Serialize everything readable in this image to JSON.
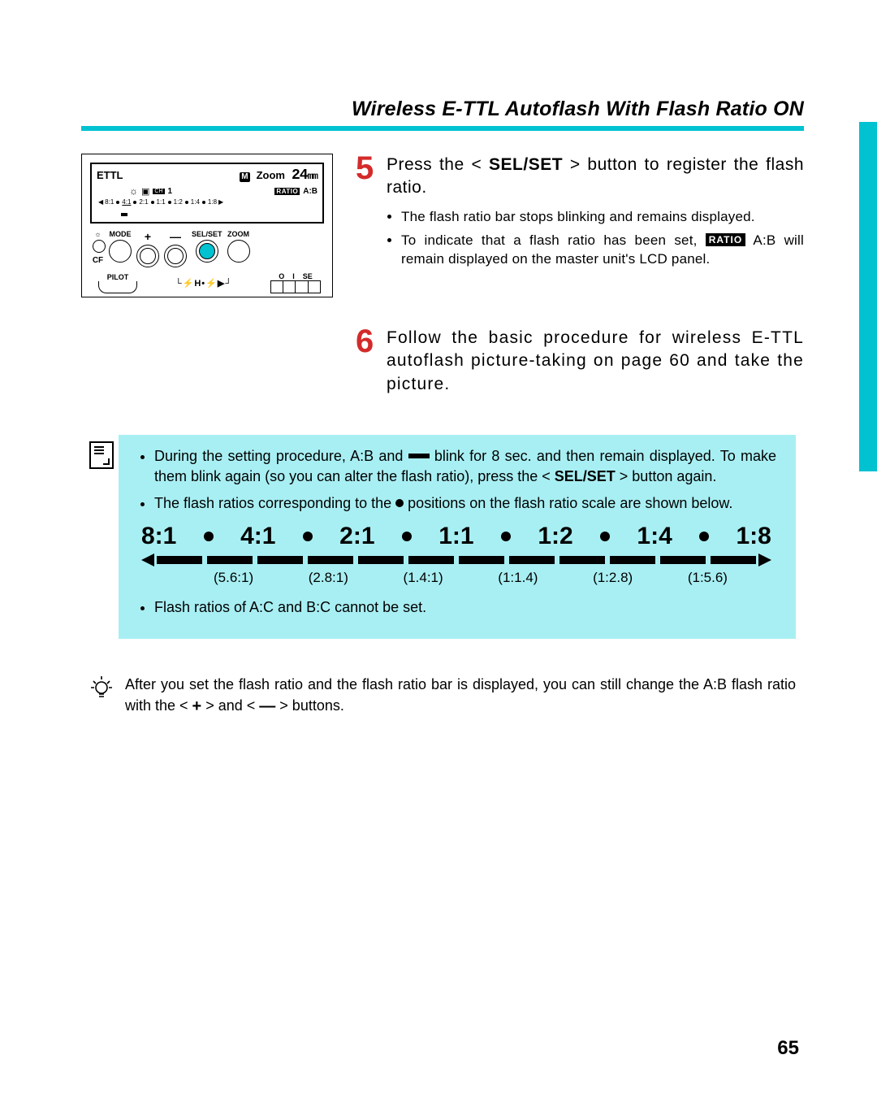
{
  "title": "Wireless E-TTL Autoflash With Flash Ratio ON",
  "lcd": {
    "mode": "ETTL",
    "m": "M",
    "zoom_label": "Zoom",
    "zoom_value": "24",
    "zoom_unit": "mm",
    "ch_label": "CH",
    "ch_value": "1",
    "ratio_tag": "RATIO",
    "ab": "A:B",
    "scale": [
      "8:1",
      "4:1",
      "2:1",
      "1:1",
      "1:2",
      "1:4",
      "1:8"
    ]
  },
  "buttons": {
    "mode": "MODE",
    "plus": "+",
    "minus": "—",
    "selset": "SEL/SET",
    "zoom": "ZOOM",
    "cf": "CF",
    "pilot": "PILOT",
    "se": "SE",
    "pwr_off": "O",
    "pwr_on": "I"
  },
  "step5": {
    "num": "5",
    "lead_a": "Press the <",
    "btn": "SEL/SET",
    "lead_b": "> button to register the flash ratio.",
    "b1": "The flash ratio bar stops blinking and remains displayed.",
    "b2a": "To indicate that a flash ratio has been set, ",
    "b2_tag": "RATIO",
    "b2b": " A:B will remain displayed on the master unit's LCD panel."
  },
  "step6": {
    "num": "6",
    "text": "Follow the basic procedure for wireless E-TTL autoflash picture-taking on page 60 and take the picture."
  },
  "note": {
    "p1a": "During the setting procedure, A:B and ",
    "p1b": " blink for 8 sec. and then remain displayed. To make them blink again (so you can alter the flash ratio), press the < ",
    "p1_btn": "SEL/SET",
    "p1c": " > button again.",
    "p2a": "The flash ratios corresponding to the ",
    "p2b": " positions on the flash ratio scale are shown below.",
    "big_scale": [
      "8:1",
      "4:1",
      "2:1",
      "1:1",
      "1:2",
      "1:4",
      "1:8"
    ],
    "sub_scale": [
      "(5.6:1)",
      "(2.8:1)",
      "(1.4:1)",
      "(1:1.4)",
      "(1:2.8)",
      "(1:5.6)"
    ],
    "p3": "Flash ratios of A:C and B:C cannot be set."
  },
  "tip": {
    "a": "After you set the flash ratio and the flash ratio bar is displayed, you can still change the A:B flash ratio with the < ",
    "b": " > and < ",
    "c": " > buttons."
  },
  "page_number": "65"
}
